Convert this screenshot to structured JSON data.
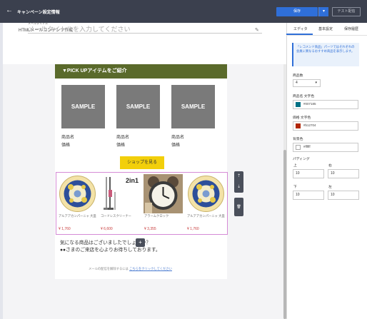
{
  "topbar": {
    "back": "←",
    "title": "キャンペーン設定情報",
    "save": "保存",
    "save_dropdown": "▾",
    "test": "テスト配信"
  },
  "header": {
    "doc_name": "HTMLメールコンテンツ作成",
    "title_label": "メールタイトル",
    "title_placeholder": "メールタイトルを入力してください",
    "edit_icon": "✎"
  },
  "email": {
    "banner": "▼PICK UPアイテムをご紹介",
    "products": [
      {
        "image": "SAMPLE",
        "name": "商品名",
        "price": "価格"
      },
      {
        "image": "SAMPLE",
        "name": "商品名",
        "price": "価格"
      },
      {
        "image": "SAMPLE",
        "name": "商品名",
        "price": "価格"
      }
    ],
    "shop_button": "ショップを見る",
    "recommend": [
      {
        "name": "アルアアカンパーニャ 大皿",
        "price": "¥ 1,760",
        "icon": "plate"
      },
      {
        "name": "コードレスクリーナー",
        "price": "¥ 6,600",
        "icon": "cleaner"
      },
      {
        "name": "アラームクロック",
        "price": "¥ 3,355",
        "icon": "clock"
      },
      {
        "name": "アルアアカンパーニャ 大皿",
        "price": "¥ 1,760",
        "icon": "plate"
      }
    ],
    "cleaner_badge": "2in1",
    "message_line1": "気になる商品はございましたでしょうか？",
    "message_line2": "●●さまのご来店を心よりお待ちしております。",
    "footer_text": "メールの配信を解除するには",
    "footer_link": "こちらをクリックしてください",
    "add_button": "+"
  },
  "tools": {
    "move_up": "⇡",
    "move_down": "⇣",
    "delete": "🗑"
  },
  "panel": {
    "tabs": [
      "エディタ",
      "基本設定",
      "保存履歴"
    ],
    "info": "「レコメンド商品」パーツではそれぞれの会員に異なるおすすめ商品を表示します。",
    "count_label": "商品数",
    "count_value": "4",
    "name_color_label": "商品名 文字色",
    "name_color": "#007185",
    "price_color_label": "価格 文字色",
    "price_color": "#b12704",
    "bg_color_label": "背景色",
    "bg_color": "#ffffff",
    "padding_label": "パディング",
    "padding": {
      "top_label": "上",
      "top": "10",
      "right_label": "右",
      "right": "10",
      "bottom_label": "下",
      "bottom": "10",
      "left_label": "左",
      "left": "10"
    }
  },
  "colors": {
    "accent": "#2f6fd8",
    "banner": "#5a6a2b",
    "shop_button": "#f2cf0b",
    "price": "#c73b3b"
  }
}
